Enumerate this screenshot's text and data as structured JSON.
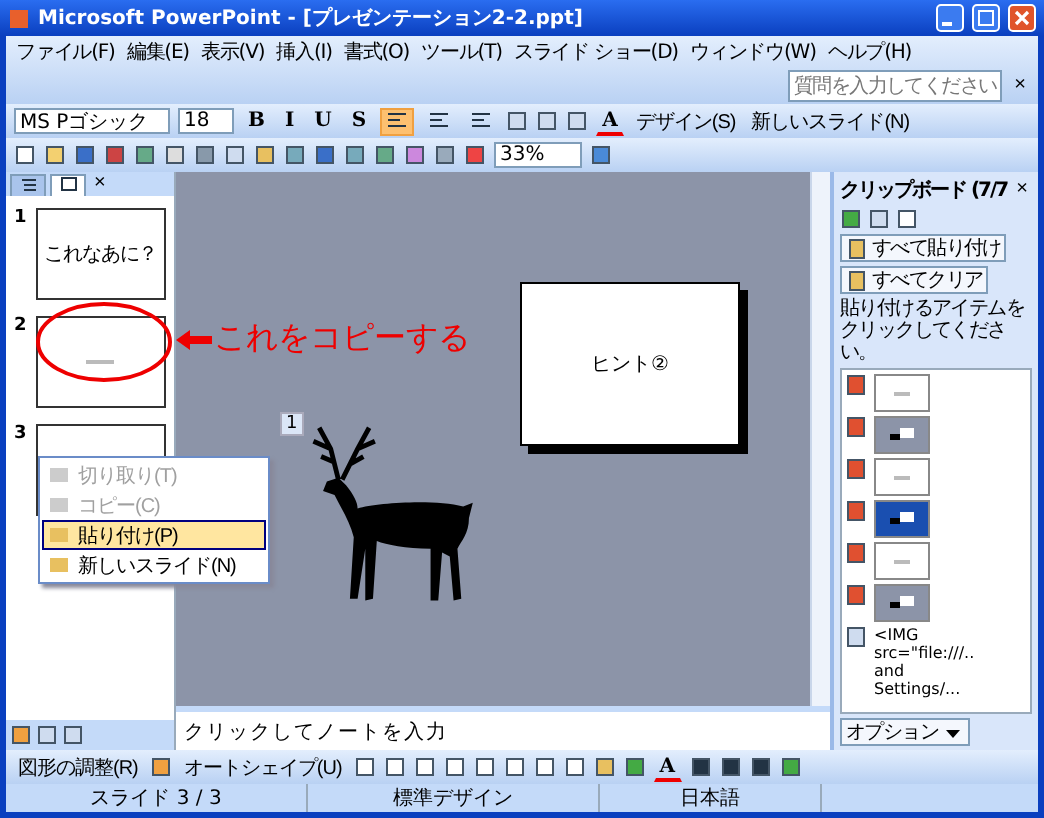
{
  "window": {
    "title": "Microsoft PowerPoint - [プレゼンテーション2-2.ppt]"
  },
  "menu_bar": {
    "items": [
      "ファイル(F)",
      "編集(E)",
      "表示(V)",
      "挿入(I)",
      "書式(O)",
      "ツール(T)",
      "スライド ショー(D)",
      "ウィンドウ(W)",
      "ヘルプ(H)"
    ],
    "help_placeholder": "質問を入力してください",
    "close": "×"
  },
  "format_toolbar": {
    "font": "MS Pゴシック",
    "size": "18",
    "styles": [
      "B",
      "I",
      "U",
      "S"
    ],
    "align": [
      {
        "selected": true
      },
      {
        "selected": false
      },
      {
        "selected": false
      }
    ],
    "font_color": "A",
    "design": "デザイン(S)",
    "new_slide": "新しいスライド(N)"
  },
  "standard_toolbar": {
    "zoom": "33%"
  },
  "slide_pane": {
    "close": "×",
    "tabs": [
      {
        "kind": "outline",
        "selected": false
      },
      {
        "kind": "slides",
        "selected": true
      }
    ],
    "slides": [
      {
        "number": "1",
        "text": "これなあに？"
      },
      {
        "number": "2"
      },
      {
        "number": "3"
      }
    ]
  },
  "context_menu": {
    "items": [
      {
        "label": "切り取り(T)",
        "disabled": true,
        "selected": false
      },
      {
        "label": "コピー(C)",
        "disabled": true,
        "selected": false
      },
      {
        "label": "貼り付け(P)",
        "disabled": false,
        "selected": true
      },
      {
        "label": "新しいスライド(N)",
        "disabled": false,
        "selected": false
      }
    ]
  },
  "annotation": {
    "text": "これをコピーする"
  },
  "slide": {
    "hint": "ヒント②",
    "badge": "1"
  },
  "notes": {
    "text": "クリックしてノートを入力"
  },
  "task_pane": {
    "title": "クリップボード (7/7",
    "close": "×",
    "paste_all": "すべて貼り付け",
    "clear_all": "すべてクリア",
    "instruction": "貼り付けるアイテムをクリックしてください。",
    "items": [
      {
        "kind": "slide"
      },
      {
        "kind": "screen"
      },
      {
        "kind": "slide"
      },
      {
        "kind": "blue-screen"
      },
      {
        "kind": "slide"
      },
      {
        "kind": "screen"
      },
      {
        "kind": "text",
        "text": "<IMG src=\"file:///.. and Settings/..."
      }
    ],
    "options": "オプション"
  },
  "drawing_toolbar": {
    "draw": "図形の調整(R)",
    "autoshape": "オートシェイプ(U)",
    "font_color": "A"
  },
  "status_bar": [
    "スライド 3 / 3",
    "標準デザイン",
    "日本語"
  ]
}
